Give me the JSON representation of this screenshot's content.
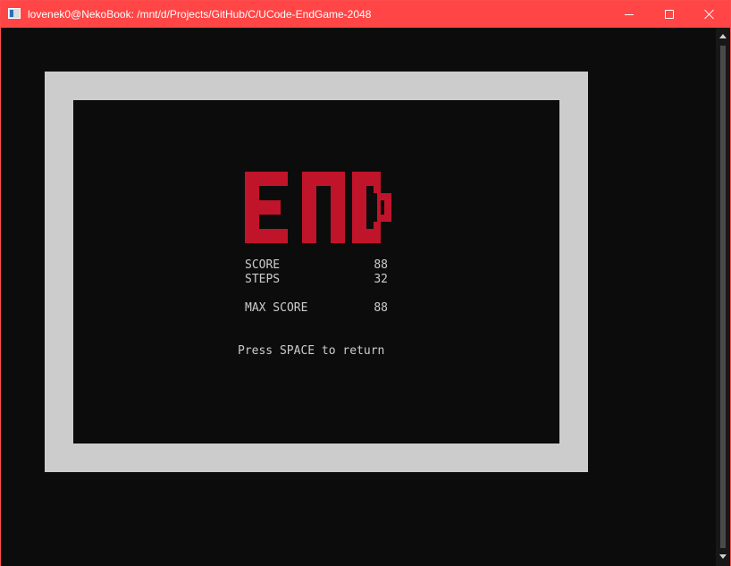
{
  "window": {
    "title": "lovenek0@NekoBook: /mnt/d/Projects/GitHub/C/UCode-EndGame-2048",
    "accent_color": "#ff4545",
    "buttons": [
      "minimize-icon",
      "maximize-icon",
      "close-icon"
    ]
  },
  "game_over": {
    "logo_text": "END",
    "logo_color": "#c0142a",
    "frame_color": "#cccccc",
    "stats": {
      "score_label": "SCORE",
      "score_value": "88",
      "steps_label": "STEPS",
      "steps_value": "32",
      "max_score_label": "MAX SCORE",
      "max_score_value": "88"
    },
    "prompt": "Press SPACE to return"
  }
}
